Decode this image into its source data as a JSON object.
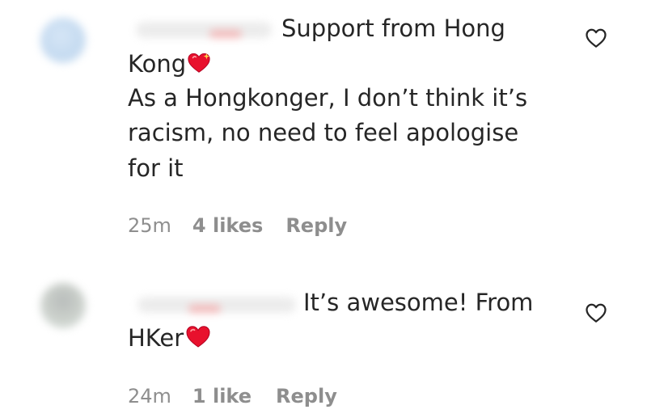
{
  "comments": [
    {
      "text_line1": "Support from Hong",
      "text_line2": "Kong",
      "text_line3": "As a Hongkonger, I don’t think it’s",
      "text_line4": "racism, no need to feel apologise",
      "text_line5": "for it",
      "time": "25m",
      "likes": "4 likes",
      "reply": "Reply",
      "emoji": "sparkling-heart"
    },
    {
      "text_line1": "It’s awesome! From",
      "text_line2": "HKer",
      "time": "24m",
      "likes": "1 like",
      "reply": "Reply",
      "emoji": "red-heart"
    }
  ],
  "icons": {
    "like": "heart-outline-icon"
  },
  "colors": {
    "text": "#262626",
    "meta": "#8e8e8e",
    "heart_red": "#e8112d"
  }
}
